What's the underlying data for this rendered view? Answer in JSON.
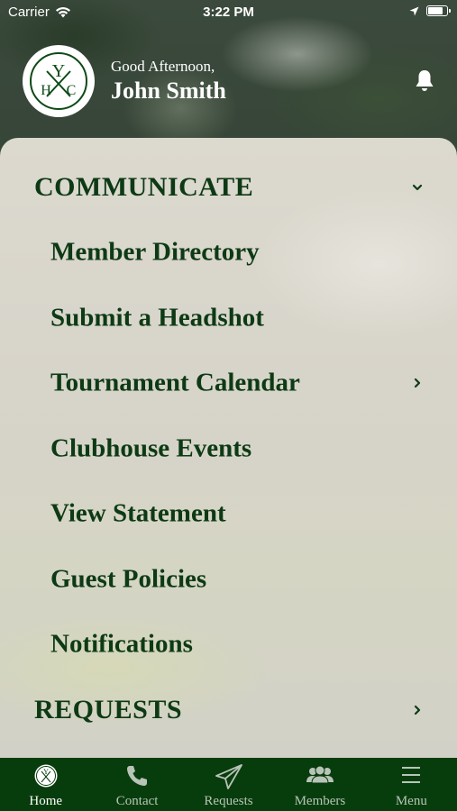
{
  "status_bar": {
    "carrier": "Carrier",
    "time": "3:22 PM",
    "battery_level": 0.9
  },
  "header": {
    "greeting": "Good Afternoon,",
    "user_name": "John Smith",
    "logo_letters": "YHC",
    "notification_icon": "bell-icon"
  },
  "menu": {
    "sections": [
      {
        "label": "COMMUNICATE",
        "expanded": true,
        "items": [
          {
            "label": "Member Directory"
          },
          {
            "label": "Submit a Headshot"
          },
          {
            "label": "Tournament Calendar",
            "has_chevron": true
          },
          {
            "label": "Clubhouse Events"
          },
          {
            "label": "View Statement"
          },
          {
            "label": "Guest Policies"
          },
          {
            "label": "Notifications"
          }
        ]
      },
      {
        "label": "REQUESTS",
        "expanded": false
      }
    ]
  },
  "tab_bar": {
    "tabs": [
      {
        "label": "Home",
        "icon": "club-logo-icon",
        "active": true
      },
      {
        "label": "Contact",
        "icon": "phone-icon"
      },
      {
        "label": "Requests",
        "icon": "paper-plane-icon"
      },
      {
        "label": "Members",
        "icon": "members-icon"
      },
      {
        "label": "Menu",
        "icon": "hamburger-menu-icon"
      }
    ]
  },
  "colors": {
    "brand_green": "#073d0c",
    "text_green": "#0d3a14",
    "panel": "#d8d5cb"
  }
}
